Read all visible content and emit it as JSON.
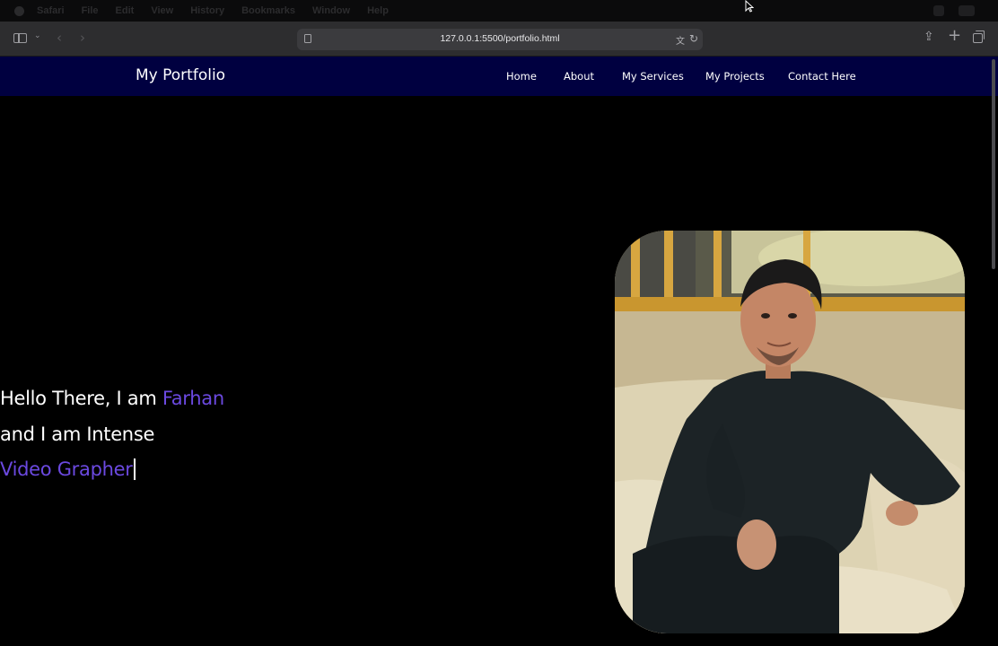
{
  "browser": {
    "url": "127.0.0.1:5500/portfolio.html",
    "menu_items": [
      "Safari",
      "File",
      "Edit",
      "View",
      "History",
      "Bookmarks",
      "Window",
      "Help"
    ]
  },
  "site": {
    "brand": "My Portfolio",
    "nav": [
      "Home",
      "About",
      "My Services",
      "My Projects",
      "Contact Here"
    ],
    "hero": {
      "line1_prefix": "Hello There, I am ",
      "name": "Farhan",
      "line2": "and I am Intense",
      "role": "Video Grapher"
    }
  },
  "colors": {
    "navbar": "#000040",
    "accent": "#6b49e0",
    "background": "#000000"
  },
  "icons": [
    "apple-icon",
    "sidebar-icon",
    "chevron-down-icon",
    "back-icon",
    "forward-icon",
    "page-icon",
    "translate-icon",
    "reload-icon",
    "share-icon",
    "plus-icon",
    "tabs-icon"
  ]
}
